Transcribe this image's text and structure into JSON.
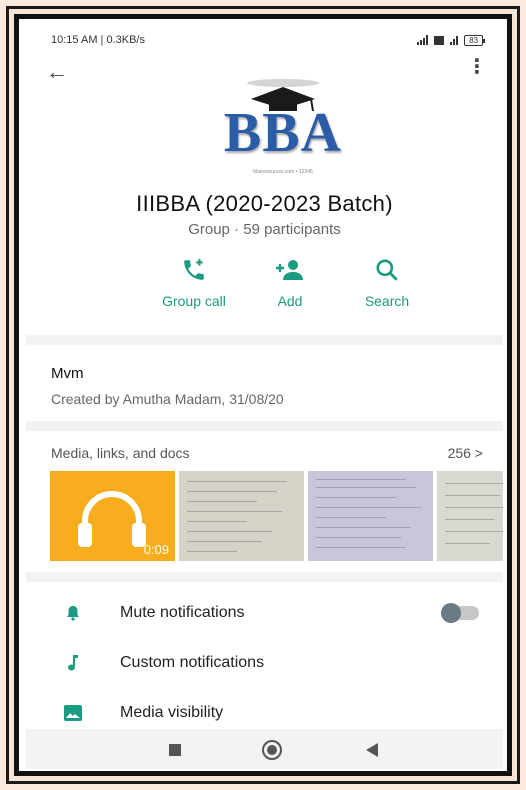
{
  "status_bar": {
    "time_speed": "10:15 AM | 0.3KB/s",
    "battery": "83"
  },
  "logo": {
    "text": "BBA",
    "small": "bbaresources.com • 12345"
  },
  "group": {
    "title": "IIIBBA (2020-2023 Batch)",
    "subtitle": "Group · 59 participants"
  },
  "actions": [
    {
      "label": "Group call",
      "icon": "group-call-icon"
    },
    {
      "label": "Add",
      "icon": "add-person-icon"
    },
    {
      "label": "Search",
      "icon": "search-icon"
    }
  ],
  "description": {
    "text": "Mvm",
    "created": "Created by Amutha Madam, 31/08/20"
  },
  "media": {
    "title": "Media, links, and docs",
    "count": "256 >",
    "audio_duration": "0:09"
  },
  "settings": [
    {
      "label": "Mute notifications",
      "icon": "bell-icon",
      "toggle": false
    },
    {
      "label": "Custom notifications",
      "icon": "music-note-icon"
    },
    {
      "label": "Media visibility",
      "icon": "image-icon"
    }
  ],
  "colors": {
    "accent": "#1a9b82",
    "audio_bg": "#f7ad1d"
  }
}
